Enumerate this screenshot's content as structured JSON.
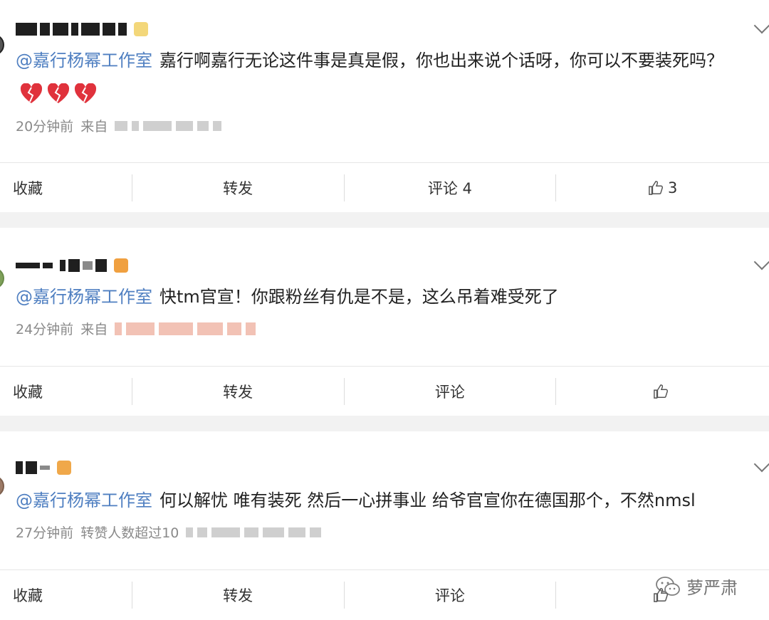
{
  "posts": [
    {
      "mention": "@嘉行杨幂工作室",
      "text": "嘉行啊嘉行无论这件事是真是假，你也出来说个话呀，你可以不要装死吗？",
      "time": "20分钟前",
      "source_prefix": "来自",
      "actions": {
        "favorite": "收藏",
        "repost": "转发",
        "comment": "评论 4",
        "likes": "3"
      }
    },
    {
      "mention": "@嘉行杨幂工作室",
      "text": "快tm官宣！你跟粉丝有仇是不是，这么吊着难受死了",
      "time": "24分钟前",
      "source_prefix": "来自",
      "actions": {
        "favorite": "收藏",
        "repost": "转发",
        "comment": "评论",
        "likes": ""
      }
    },
    {
      "mention": "@嘉行杨幂工作室",
      "text": "何以解忧 唯有装死 然后一心拼事业 给爷官宣你在德国那个，不然nmsl",
      "time": "27分钟前",
      "source_prefix": "转赞人数超过10",
      "actions": {
        "favorite": "收藏",
        "repost": "转发",
        "comment": "评论",
        "likes": ""
      }
    }
  ],
  "watermark": {
    "text": "萝严肃"
  },
  "colors": {
    "mention": "#4f7fc1",
    "meta": "#8a8a8a",
    "separator": "#f2f2f2"
  }
}
